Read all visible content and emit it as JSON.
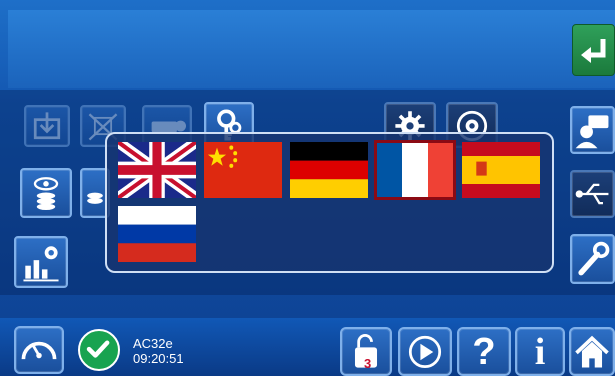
{
  "status": {
    "device": "AC32e",
    "time": "09:20:51"
  },
  "bottom_bar": {
    "help_label": "?",
    "info_label": "i",
    "lock_number": "3"
  },
  "language_popup": {
    "flags": [
      {
        "name": "flag-uk",
        "selected": false
      },
      {
        "name": "flag-china",
        "selected": false
      },
      {
        "name": "flag-germany",
        "selected": false
      },
      {
        "name": "flag-france",
        "selected": true
      },
      {
        "name": "flag-spain",
        "selected": false
      },
      {
        "name": "flag-russia",
        "selected": false
      }
    ]
  },
  "colors": {
    "accent_green": "#1b7a3c",
    "selection": "#8b0a14"
  },
  "icons": [
    "enter-icon",
    "download-icon",
    "disabled-process-icon",
    "machine-icon",
    "keys-icon",
    "gear-icon",
    "gear-refresh-icon",
    "user-chat-icon",
    "eye-coins-icon",
    "coins-icon",
    "usb-icon",
    "statistics-gear-icon",
    "wrench-icon",
    "speedometer-icon",
    "check-icon",
    "lock-icon",
    "play-icon",
    "help-icon",
    "info-icon",
    "home-icon"
  ]
}
